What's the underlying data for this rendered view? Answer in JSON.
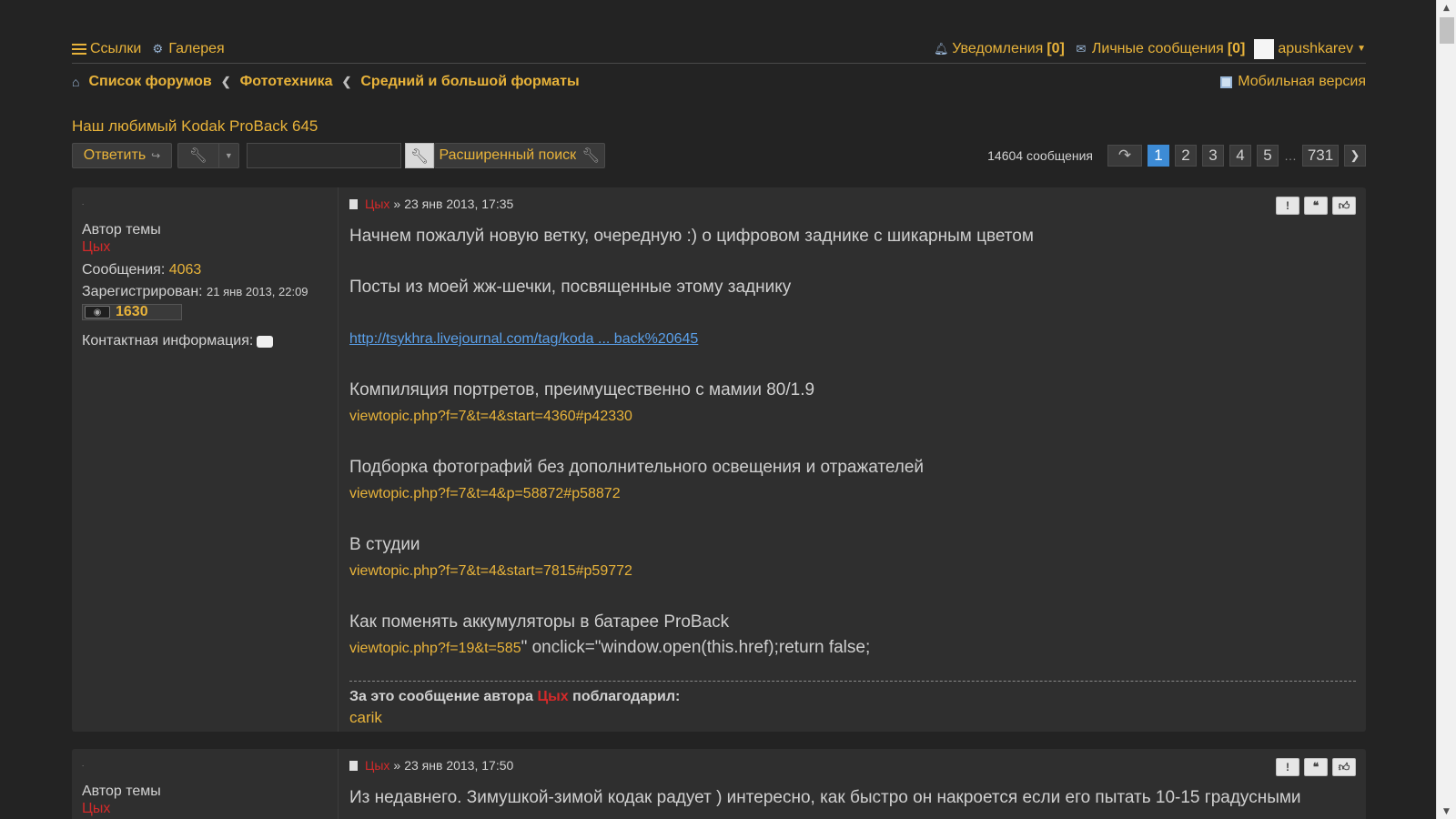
{
  "nav": {
    "links_label": "Ссылки",
    "gallery_label": "Галерея",
    "notifications_label": "Уведомления",
    "notifications_count": "[0]",
    "messages_label": "Личные сообщения",
    "messages_count": "[0]",
    "username": "apushkarev"
  },
  "breadcrumb": {
    "items": [
      "Список форумов",
      "Фототехника",
      "Средний и большой форматы"
    ],
    "mobile_label": "Мобильная версия"
  },
  "topic": {
    "title": "Наш любимый Kodak ProBack 645"
  },
  "toolbar": {
    "reply_label": "Ответить",
    "search_value": "",
    "advanced_search_label": "Расширенный поиск"
  },
  "pagination": {
    "count_label": "14604 сообщения",
    "pages": [
      "1",
      "2",
      "3",
      "4",
      "5"
    ],
    "ellipsis": "…",
    "last_page": "731",
    "current_page": "1"
  },
  "posts": [
    {
      "dot": ".",
      "role": "Автор темы",
      "author": "Цых",
      "posts_label": "Сообщения:",
      "posts_count": "4063",
      "registered_label": "Зарегистрирован:",
      "registered_date": "21 янв 2013, 22:09",
      "reputation": "1630",
      "contact_label": "Контактная информация:",
      "sep": "»",
      "date": "23 янв 2013, 17:35",
      "lines": {
        "l1": "Начнем пожалуй новую ветку, очередную :) о цифровом заднике с шикарным цветом",
        "l2": "Посты из моей жж-шечки, посвященные этому заднику",
        "l3_link": "http://tsykhra.livejournal.com/tag/koda ... back%20645",
        "l4": "Компиляция портретов, преимущественно с мамии 80/1.9",
        "l4_link": "viewtopic.php?f=7&t=4&start=4360#p42330",
        "l5": "Подборка фотографий без дополнительного освещения и отражателей",
        "l5_link": "viewtopic.php?f=7&t=4&p=58872#p58872",
        "l6": "В студии",
        "l6_link": "viewtopic.php?f=7&t=4&start=7815#p59772",
        "l7": "Как поменять аккумуляторы в батарее ProBack",
        "l7_link": "viewtopic.php?f=19&t=585",
        "l7_tail": "\" onclick=\"window.open(this.href);return false;"
      },
      "thanks_prefix": "За это сообщение автора",
      "thanks_author": "Цых",
      "thanks_suffix": "поблагодарил:",
      "thanked_by": "carik"
    },
    {
      "dot": ".",
      "role": "Автор темы",
      "author": "Цых",
      "sep": "»",
      "date": "23 янв 2013, 17:50",
      "text": "Из недавнего. Зимушкой-зимой кодак радует ) интересно, как быстро он накроется если его пытать 10-15 градусными"
    }
  ],
  "icons": {
    "accent": "#e8b33a",
    "author_color": "#d42a2a",
    "active_page": "#3d8bd5"
  }
}
